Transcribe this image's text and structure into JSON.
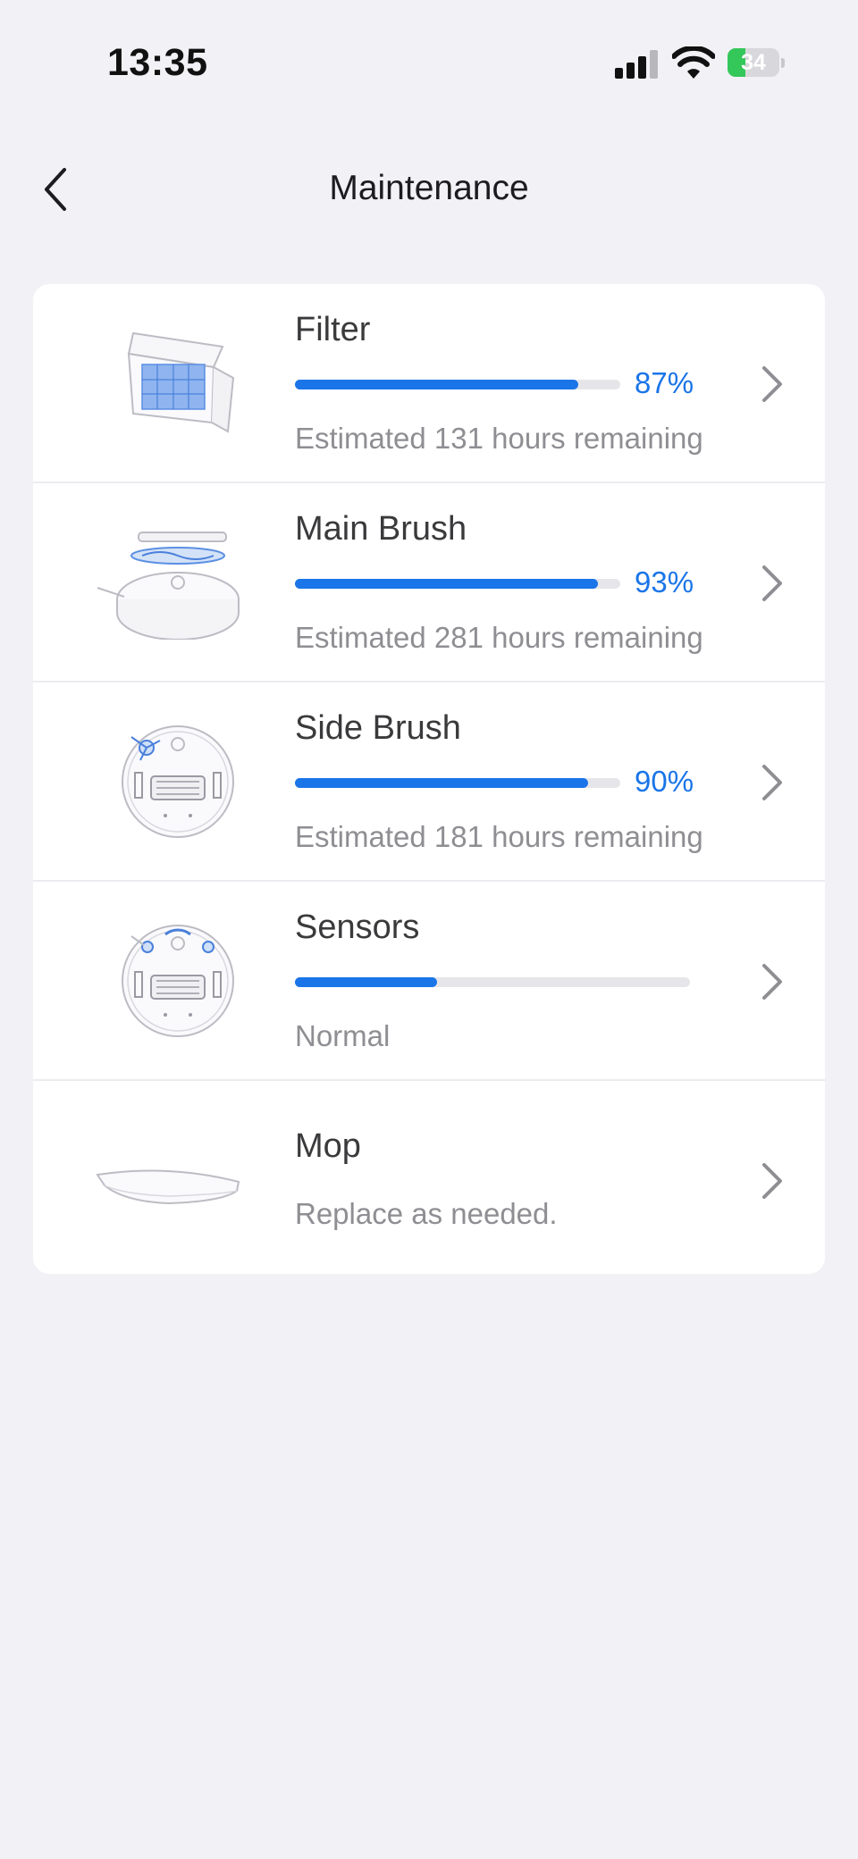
{
  "status_bar": {
    "time": "13:35",
    "battery": "34",
    "battery_percent": 34,
    "icons": [
      "signal-icon",
      "wifi-icon",
      "battery-charging-icon"
    ]
  },
  "nav": {
    "title": "Maintenance",
    "back_icon": "chevron-left-icon"
  },
  "colors": {
    "accent": "#1a75e8",
    "track": "#e6e6ea",
    "background": "#f1f1f6",
    "battery": "#34c759"
  },
  "items": [
    {
      "title": "Filter",
      "percent_label": "87%",
      "progress": 87,
      "subtitle": "Estimated 131 hours remaining",
      "icon": "filter-icon"
    },
    {
      "title": "Main Brush",
      "percent_label": "93%",
      "progress": 93,
      "subtitle": "Estimated 281 hours remaining",
      "icon": "main-brush-icon"
    },
    {
      "title": "Side Brush",
      "percent_label": "90%",
      "progress": 90,
      "subtitle": "Estimated 181 hours remaining",
      "icon": "side-brush-icon"
    },
    {
      "title": "Sensors",
      "percent_label": "",
      "progress": 36,
      "subtitle": "Normal",
      "icon": "sensors-icon"
    },
    {
      "title": "Mop",
      "subtitle": "Replace as needed.",
      "icon": "mop-icon"
    }
  ]
}
